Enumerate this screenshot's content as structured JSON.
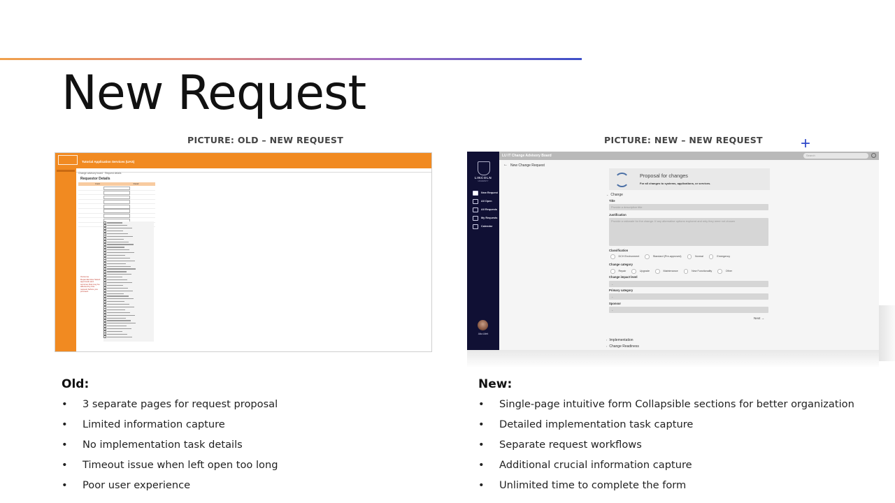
{
  "slide": {
    "title": "New Request",
    "caption_old": "PICTURE: OLD – NEW REQUEST",
    "caption_new": "PICTURE: NEW – NEW REQUEST",
    "plus_icon": "+",
    "accent_colors": [
      "#f0a04b",
      "#a06cc0",
      "#3d4fc8"
    ]
  },
  "old_screen": {
    "app_title": "Tutorial Application Services (UAS)",
    "breadcrumb": "Change advisory board · Request details",
    "heading": "Requestor Details",
    "table_headers": [
      "Field",
      "Detail"
    ],
    "red_note": "Outcome Dependencies Select approvals and services that may be affected by this request before you proceed.",
    "brand_color": "#f18a21"
  },
  "new_screen": {
    "app_title": "LU IT Change Advisory Board",
    "search_placeholder": "Search",
    "university": "LINCOLN",
    "university_sub": "UNIVERSITY",
    "nav_items": [
      "New Request",
      "All Open",
      "All Requests",
      "My Requests",
      "Calendar"
    ],
    "user_name": "Alka Allett",
    "back_label": "←",
    "page_title": "New Change Request",
    "form_title": "Proposal for changes",
    "form_subtitle": "For all changes to systems, applications, or services.",
    "section_change": "Change",
    "title_label": "Title",
    "title_placeholder": "Provide a descriptive title",
    "justification_label": "Justification",
    "justification_placeholder": "Provide a rationale for the change. If any alternative options explored and why they were not chosen",
    "classification_label": "Classification",
    "classification_options": [
      "DCH Environment",
      "Standard (Pre-approved)",
      "Normal",
      "Emergency"
    ],
    "category_label": "Change category",
    "category_options": [
      "Repair",
      "Upgrade",
      "Maintenance",
      "New Functionality",
      "Other"
    ],
    "impact_label": "Change impact level",
    "primary_label": "Primary category",
    "sponsor_label": "Sponsor",
    "next_label": "Next →",
    "section_implementation": "Implementation",
    "section_readiness": "Change Readiness",
    "nav_color": "#101034"
  },
  "old_list": {
    "heading": "Old:",
    "items": [
      "3 separate pages for request proposal",
      "Limited information capture",
      "No implementation task details",
      "Timeout issue when left open too long",
      "Poor user experience"
    ]
  },
  "new_list": {
    "heading": "New:",
    "items": [
      "Single-page intuitive form Collapsible sections for better organization",
      "Detailed implementation task capture",
      "Separate request workflows",
      "Additional crucial information capture",
      "Unlimited time to complete the form"
    ]
  },
  "bullet": "•"
}
